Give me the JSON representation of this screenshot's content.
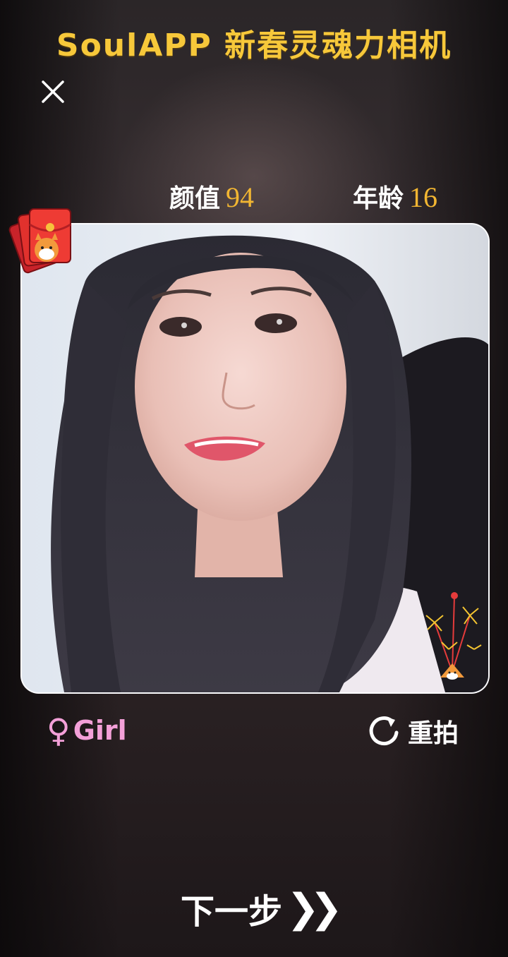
{
  "header": {
    "title": "SoulAPP 新春灵魂力相机"
  },
  "toolbar": {
    "close_icon": "close-icon"
  },
  "scores": {
    "beauty_label": "颜值",
    "beauty_value": "94",
    "age_label": "年龄",
    "age_value": "16"
  },
  "photo": {
    "decorations": [
      "red-envelope-icon",
      "fireworks-icon"
    ]
  },
  "result": {
    "gender_symbol": "♀",
    "gender_label": "Girl",
    "retake_label": "重拍"
  },
  "footer": {
    "next_label": "下一步",
    "next_chevrons": "❯❯"
  },
  "colors": {
    "title": "#f7c83a",
    "score_value": "#f2b632",
    "gender": "#f3a0d8",
    "text": "#ffffff"
  }
}
